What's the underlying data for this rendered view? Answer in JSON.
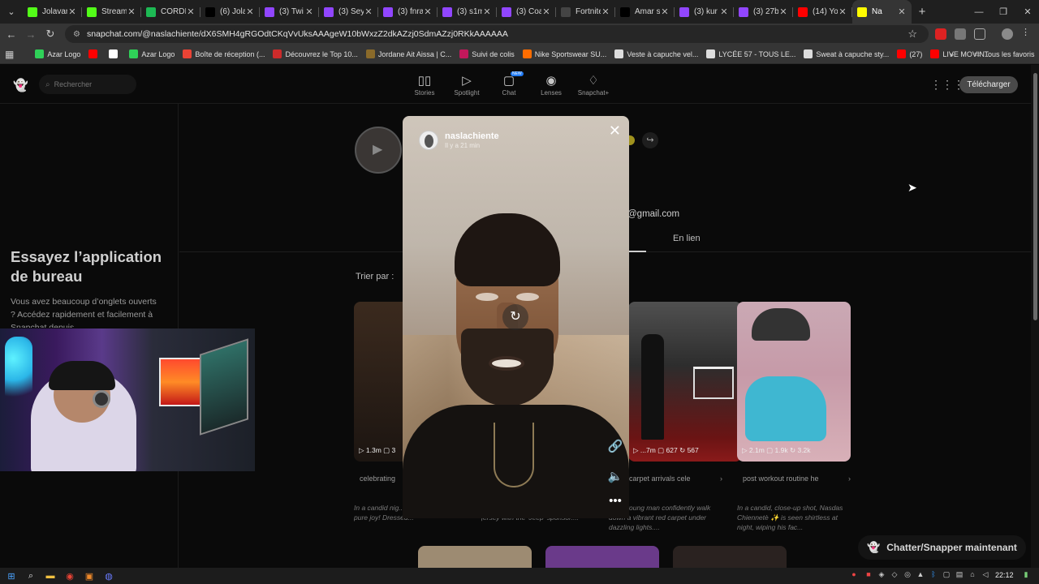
{
  "browser": {
    "tabs": [
      {
        "label": "Jolavan",
        "color": "#53fc18",
        "active": false
      },
      {
        "label": "Stream",
        "color": "#53fc18",
        "active": false
      },
      {
        "label": "CORDI",
        "color": "#1db954",
        "active": false
      },
      {
        "label": "(6) Jola",
        "color": "#000000",
        "active": false
      },
      {
        "label": "(3) Twi",
        "color": "#9146ff",
        "active": false
      },
      {
        "label": "(3) Sey",
        "color": "#9146ff",
        "active": false
      },
      {
        "label": "(3) fnra",
        "color": "#9146ff",
        "active": false
      },
      {
        "label": "(3) s1m",
        "color": "#9146ff",
        "active": false
      },
      {
        "label": "(3) Coa",
        "color": "#9146ff",
        "active": false
      },
      {
        "label": "Fortnite",
        "color": "#444444",
        "active": false
      },
      {
        "label": "Amar s",
        "color": "#000000",
        "active": false
      },
      {
        "label": "(3) kur",
        "color": "#9146ff",
        "active": false
      },
      {
        "label": "(3) 27b",
        "color": "#9146ff",
        "active": false
      },
      {
        "label": "(14) Yo",
        "color": "#ff0000",
        "active": false
      },
      {
        "label": "Na",
        "color": "#fffc00",
        "active": true
      }
    ],
    "url": "snapchat.com/@naslachiente/dX6SMH4gRGOdtCKqVvUksAAAgeW10bWxzZ2dkAZzj0SdmAZzj0RKkAAAAAA",
    "bookmarks": [
      {
        "label": "Azar Logo",
        "color": "#2fd158"
      },
      {
        "label": "",
        "color": "#ff0000"
      },
      {
        "label": "",
        "color": "#ffffff"
      },
      {
        "label": "Azar Logo",
        "color": "#2fd158"
      },
      {
        "label": "Boîte de réception (...",
        "color": "#ea4335"
      },
      {
        "label": "Découvrez le Top 10...",
        "color": "#cc2b2b"
      },
      {
        "label": "Jordane Ait Aissa | C...",
        "color": "#8a6a2a"
      },
      {
        "label": "Suivi de colis",
        "color": "#c2185b"
      },
      {
        "label": "Nike Sportswear SU...",
        "color": "#ff6d00"
      },
      {
        "label": "Veste à capuche vel...",
        "color": "#dddddd"
      },
      {
        "label": "LYCÉE 57 - TOUS LE...",
        "color": "#dddddd"
      },
      {
        "label": "Sweat à capuche sty...",
        "color": "#dddddd"
      },
      {
        "label": "(27)",
        "color": "#ff0000"
      },
      {
        "label": "LIVE MOVIN...",
        "color": "#ff0000"
      }
    ],
    "all_bookmarks": "Tous les favoris"
  },
  "snap": {
    "search_placeholder": "Rechercher",
    "nav": [
      {
        "label": "Stories",
        "icon": "stories-icon",
        "glyph": "▯▯"
      },
      {
        "label": "Spotlight",
        "icon": "spotlight-icon",
        "glyph": "▷"
      },
      {
        "label": "Chat",
        "icon": "chat-icon",
        "glyph": "▢",
        "badge": "NEW"
      },
      {
        "label": "Lenses",
        "icon": "lenses-icon",
        "glyph": "◉"
      },
      {
        "label": "Snapchat+",
        "icon": "snapchat-plus-icon",
        "glyph": "♢"
      }
    ],
    "download_label": "Télécharger",
    "left_title": "Essayez l’application de bureau",
    "left_text": "Vous avez beaucoup d’onglets ouverts ? Accédez rapidement et facilement à Snapchat depuis",
    "email_fragment": "@gmail.com",
    "tab_enlien": "En lien",
    "sort_label": "Trier par :",
    "cards": [
      {
        "stats": "▷ 1.3m  ▢ 3",
        "chip": "celebrating",
        "desc": "In a candid nig... ...a victory with pure joy! Dressed...",
        "bg": "#2a2420"
      },
      {
        "stats": "▷ ...7m  ▢ 627  ↻ 567",
        "chip": "carpet arrivals   cele",
        "desc": "...s a young man confidently walk down a vibrant red carpet under dazzling lights....",
        "bg": "#3a3a3a"
      },
      {
        "stats": "▷ 2.1m  ▢ 1.9k  ↻ 3.2k",
        "chip": "post workout routine   he",
        "desc": "In a candid, close-up shot, Nasdas Chiennetè ✨ is seen shirtless at night, wiping his fac...",
        "bg": "#5a4a4a"
      }
    ],
    "middle_desc": "...ed by a man in a black Adidas jersey with the 'Jeep' sponsor....",
    "chat_now": "Chatter/Snapper maintenant"
  },
  "story": {
    "username": "naslachiente",
    "time": "Il y a 21 min"
  },
  "taskbar": {
    "time": "22:12"
  }
}
